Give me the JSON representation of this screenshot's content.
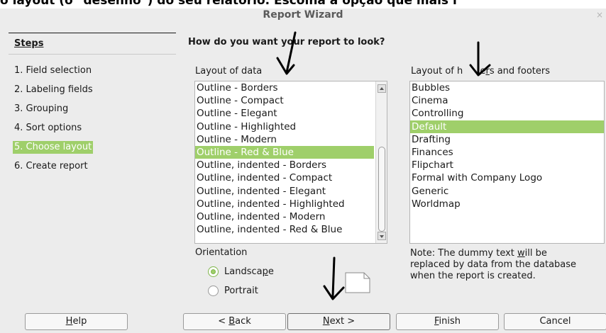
{
  "caption": "o layout (o \"desenho\") do seu relatório. Escolha a opção que mais l",
  "window": {
    "title": "Report Wizard",
    "close_glyph": "×"
  },
  "steps": {
    "title": "Steps",
    "items": [
      {
        "label": "1. Field selection",
        "active": false
      },
      {
        "label": "2. Labeling fields",
        "active": false
      },
      {
        "label": "3. Grouping",
        "active": false
      },
      {
        "label": "4. Sort options",
        "active": false
      },
      {
        "label": "5. Choose layout",
        "active": true
      },
      {
        "label": "6. Create report",
        "active": false
      }
    ]
  },
  "main": {
    "heading": "How do you want your report to look?",
    "layout_of_data": {
      "label": "Layout of data",
      "items": [
        "Outline - Borders",
        "Outline - Compact",
        "Outline - Elegant",
        "Outline - Highlighted",
        "Outline - Modern",
        "Outline - Red & Blue",
        "Outline, indented - Borders",
        "Outline, indented - Compact",
        "Outline, indented - Elegant",
        "Outline, indented - Highlighted",
        "Outline, indented - Modern",
        "Outline, indented - Red & Blue"
      ],
      "selected": "Outline - Red & Blue"
    },
    "layout_headers": {
      "label_pre": "Layout of h",
      "label_obscured": "ead",
      "label_mid": "e",
      "label_u": "r",
      "label_post": "s and footers",
      "items": [
        "Bubbles",
        "Cinema",
        "Controlling",
        "Default",
        "Drafting",
        "Finances",
        "Flipchart",
        "Formal with Company Logo",
        "Generic",
        "Worldmap"
      ],
      "selected": "Default"
    },
    "orientation": {
      "label": "Orientation",
      "landscape_pre": "Landsca",
      "landscape_u": "p",
      "landscape_post": "e",
      "portrait": "Portrait",
      "selected": "Landscape"
    },
    "note": {
      "pre": "Note: The dummy text ",
      "u": "w",
      "post": "ill be replaced by data from the database when the report is created."
    }
  },
  "buttons": {
    "help_u": "H",
    "help_rest": "elp",
    "back_pre": "< ",
    "back_u": "B",
    "back_rest": "ack",
    "next_u": "N",
    "next_rest": "ext >",
    "finish_u": "F",
    "finish_rest": "inish",
    "cancel": "Cancel"
  },
  "colors": {
    "selection": "#9fcf6a",
    "dialog_bg": "#ececec"
  }
}
